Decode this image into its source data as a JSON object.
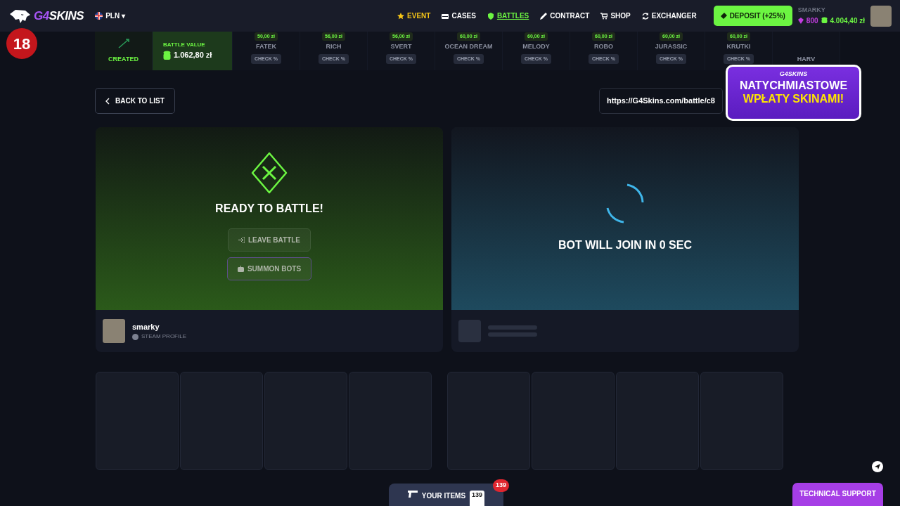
{
  "header": {
    "logo": {
      "prefix": "G4",
      "suffix": "SKINS"
    },
    "currency": {
      "code": "PLN",
      "caret": "▾"
    },
    "nav": [
      {
        "label": "EVENT",
        "featured": true,
        "selected": false
      },
      {
        "label": "CASES",
        "featured": false,
        "selected": false
      },
      {
        "label": "BATTLES",
        "featured": false,
        "selected": true
      },
      {
        "label": "CONTRACT",
        "featured": false,
        "selected": false
      },
      {
        "label": "SHOP",
        "featured": false,
        "selected": false
      },
      {
        "label": "EXCHANGER",
        "featured": false,
        "selected": false
      }
    ],
    "deposit": "DEPOSIT (+25%)",
    "user": {
      "name": "SMARKY",
      "gems": "800",
      "balance": "4.004,40 zł"
    }
  },
  "age_badge": "18",
  "case_strip": {
    "status": "CREATED",
    "battle_value_label": "BATTLE VALUE",
    "battle_value": "1.062,80 zł",
    "cases": [
      {
        "price": "50,00 zł",
        "name": "FATEK",
        "check": "CHECK %"
      },
      {
        "price": "56,00 zł",
        "name": "RICH",
        "check": "CHECK %"
      },
      {
        "price": "56,00 zł",
        "name": "SVERT",
        "check": "CHECK %"
      },
      {
        "price": "60,00 zł",
        "name": "OCEAN DREAM",
        "check": "CHECK %"
      },
      {
        "price": "60,00 zł",
        "name": "MELODY",
        "check": "CHECK %"
      },
      {
        "price": "60,00 zł",
        "name": "ROBO",
        "check": "CHECK %"
      },
      {
        "price": "60,00 zł",
        "name": "JURASSIC",
        "check": "CHECK %"
      },
      {
        "price": "60,00 zł",
        "name": "KRUTKI",
        "check": "CHECK %"
      },
      {
        "name": "HARV"
      }
    ]
  },
  "back_button": "BACK TO LIST",
  "battle_link": "https://G4Skins.com/battle/c8",
  "promo_banner": {
    "brand": "G4SKINS",
    "line_1": "NATYCHMIASTOWE",
    "line_2": "WPŁATY SKINAMI!"
  },
  "players": [
    {
      "kind": "player",
      "title": "READY TO BATTLE!",
      "buttons": [
        "LEAVE BATTLE",
        "SUMMON BOTS"
      ],
      "name": "smarky",
      "profile": "STEAM PROFILE"
    },
    {
      "kind": "bot",
      "title": "BOT WILL JOIN IN 0 SEC"
    }
  ],
  "footer": {
    "items_button": "YOUR ITEMS",
    "items_count": "139",
    "items_badge": "139",
    "support": "TECHNICAL SUPPORT"
  }
}
